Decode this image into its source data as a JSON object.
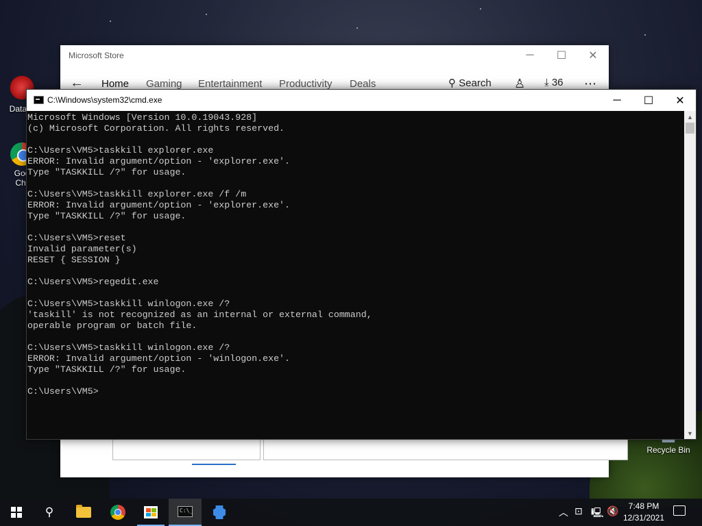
{
  "desktop": {
    "icons": [
      {
        "label": "DataW"
      },
      {
        "label": "Goo\nChr"
      },
      {
        "label": "Recycle Bin"
      }
    ]
  },
  "store": {
    "title": "Microsoft Store",
    "minimize": "─",
    "maximize": "☐",
    "close": "✕",
    "back": "←",
    "tabs": [
      {
        "label": "Home"
      },
      {
        "label": "Gaming"
      },
      {
        "label": "Entertainment"
      },
      {
        "label": "Productivity"
      },
      {
        "label": "Deals"
      }
    ],
    "search_label": "Search",
    "user_glyph": "♙",
    "downloads_count": "36",
    "more_glyph": "⋯"
  },
  "cmd": {
    "title": "C:\\Windows\\system32\\cmd.exe",
    "minimize": "─",
    "maximize": "☐",
    "close": "✕",
    "lines": [
      "Microsoft Windows [Version 10.0.19043.928]",
      "(c) Microsoft Corporation. All rights reserved.",
      "",
      "C:\\Users\\VM5>taskkill explorer.exe",
      "ERROR: Invalid argument/option - 'explorer.exe'.",
      "Type \"TASKKILL /?\" for usage.",
      "",
      "C:\\Users\\VM5>taskkill explorer.exe /f /m",
      "ERROR: Invalid argument/option - 'explorer.exe'.",
      "Type \"TASKKILL /?\" for usage.",
      "",
      "C:\\Users\\VM5>reset",
      "Invalid parameter(s)",
      "RESET { SESSION }",
      "",
      "C:\\Users\\VM5>regedit.exe",
      "",
      "C:\\Users\\VM5>taskkill winlogon.exe /?",
      "'taskill' is not recognized as an internal or external command,",
      "operable program or batch file.",
      "",
      "C:\\Users\\VM5>taskkill winlogon.exe /?",
      "ERROR: Invalid argument/option - 'winlogon.exe'.",
      "Type \"TASKKILL /?\" for usage.",
      "",
      "C:\\Users\\VM5>"
    ],
    "scroll_up": "▲",
    "scroll_down": "▼"
  },
  "taskbar": {
    "search_glyph": "⚲",
    "cmd_glyph": "C:\\_",
    "tray": {
      "chevron": "︿",
      "time": "7:48 PM",
      "date": "12/31/2021"
    }
  },
  "colors": {
    "console_bg": "#0c0c0c",
    "console_text": "#cccccc",
    "accent": "#7ab3ff"
  }
}
